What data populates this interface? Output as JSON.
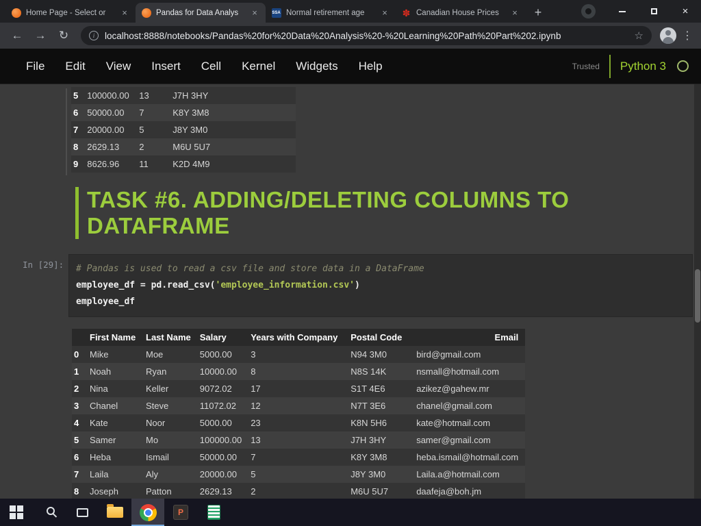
{
  "browser": {
    "tabs": [
      {
        "title": "Home Page - Select or ",
        "favicon": "jupyter-icon",
        "active": false
      },
      {
        "title": "Pandas for Data Analys",
        "favicon": "jupyter-icon",
        "active": true
      },
      {
        "title": "Normal retirement age ",
        "favicon": "ssa-icon",
        "active": false
      },
      {
        "title": "Canadian House Prices ",
        "favicon": "maple-leaf-icon",
        "active": false
      }
    ],
    "url": "localhost:8888/notebooks/Pandas%20for%20Data%20Analysis%20-%20Learning%20Path%20Part%202.ipynb"
  },
  "icons": {
    "back": "←",
    "forward": "→",
    "reload": "↻",
    "info": "i",
    "star": "☆",
    "menu_dots": "⋮",
    "new_tab": "+",
    "tab_close": "×",
    "close_window": "×",
    "maple": "✽",
    "ssa": "SSA",
    "ppt_letter": "P"
  },
  "jupyter": {
    "menu": [
      "File",
      "Edit",
      "View",
      "Insert",
      "Cell",
      "Kernel",
      "Widgets",
      "Help"
    ],
    "trusted_label": "Trusted",
    "kernel_name": "Python 3"
  },
  "scrolled_table": {
    "rows": [
      [
        "5",
        "100000.00",
        "13",
        "J7H 3HY"
      ],
      [
        "6",
        "50000.00",
        "7",
        "K8Y 3M8"
      ],
      [
        "7",
        "20000.00",
        "5",
        "J8Y 3M0"
      ],
      [
        "8",
        "2629.13",
        "2",
        "M6U 5U7"
      ],
      [
        "9",
        "8626.96",
        "11",
        "K2D 4M9"
      ]
    ]
  },
  "markdown_cell": {
    "heading": "TASK #6. ADDING/DELETING COLUMNS TO DATAFRAME"
  },
  "code_cell": {
    "prompt": "In [29]:",
    "comment": "# Pandas is used to read a csv file and store data in a DataFrame",
    "code_pre": "employee_df = pd.read_csv(",
    "code_string": "'employee_information.csv'",
    "code_post": ")",
    "line3": "employee_df"
  },
  "dataframe": {
    "headers": [
      "",
      "First Name",
      "Last Name",
      "Salary",
      "Years with Company",
      "Postal Code",
      "Email"
    ],
    "rows": [
      [
        "0",
        "Mike",
        "Moe",
        "5000.00",
        "3",
        "N94 3M0",
        "bird@gmail.com"
      ],
      [
        "1",
        "Noah",
        "Ryan",
        "10000.00",
        "8",
        "N8S 14K",
        "nsmall@hotmail.com"
      ],
      [
        "2",
        "Nina",
        "Keller",
        "9072.02",
        "17",
        "S1T 4E6",
        "azikez@gahew.mr"
      ],
      [
        "3",
        "Chanel",
        "Steve",
        "11072.02",
        "12",
        "N7T 3E6",
        "chanel@gmail.com"
      ],
      [
        "4",
        "Kate",
        "Noor",
        "5000.00",
        "23",
        "K8N 5H6",
        "kate@hotmail.com"
      ],
      [
        "5",
        "Samer",
        "Mo",
        "100000.00",
        "13",
        "J7H 3HY",
        "samer@gmail.com"
      ],
      [
        "6",
        "Heba",
        "Ismail",
        "50000.00",
        "7",
        "K8Y 3M8",
        "heba.ismail@hotmail.com"
      ],
      [
        "7",
        "Laila",
        "Aly",
        "20000.00",
        "5",
        "J8Y 3M0",
        "Laila.a@hotmail.com"
      ],
      [
        "8",
        "Joseph",
        "Patton",
        "2629.13",
        "2",
        "M6U 5U7",
        "daafeja@boh.jm"
      ]
    ]
  },
  "taskbar": {
    "icons": [
      "start",
      "search",
      "task-view",
      "file-explorer",
      "chrome",
      "powerpoint",
      "excel"
    ],
    "active_app": "chrome"
  }
}
